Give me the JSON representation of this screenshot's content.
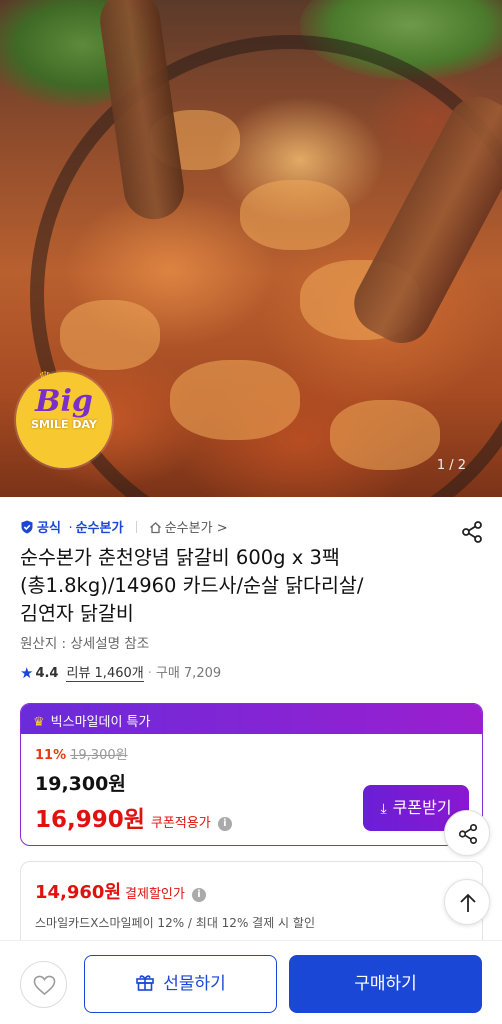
{
  "hero": {
    "badge_big": "Big",
    "badge_sub": "SMILE DAY",
    "page_indicator": "1 / 2",
    "icon": "big-smile-day-badge"
  },
  "seller": {
    "official_label": "공식",
    "brand": "순수본가",
    "store_link": "순수본가",
    "store_chevron": ">",
    "icons": [
      "shield-check-icon",
      "house-icon",
      "share-icon"
    ]
  },
  "product": {
    "title_line1": "순수본가 춘천양념 닭갈비 600g x 3팩",
    "title_line2": "(총1.8kg)/14960 카드사/순살 닭다리살/",
    "title_line3": "김연자 닭갈비",
    "origin": "원산지 : 상세설명 참조",
    "rating": "4.4",
    "review_label": "리뷰 1,460개",
    "buy_label": "구매 7,209"
  },
  "promo": {
    "header": "빅스마일데이 특가",
    "discount_pct": "11%",
    "original_price": "19,300원",
    "price": "19,300원",
    "sale_price": "16,990원",
    "coupon_label": "쿠폰적용가",
    "coupon_button": "쿠폰받기",
    "accent": "#8b2bd6"
  },
  "payment": {
    "price": "14,960원",
    "label": "결제할인가",
    "desc": "스마일카드X스마일페이 12% / 최대 12% 결제 시 할인"
  },
  "bottom": {
    "gift_label": "선물하기",
    "buy_label": "구매하기",
    "primary_color": "#1a47d6"
  }
}
